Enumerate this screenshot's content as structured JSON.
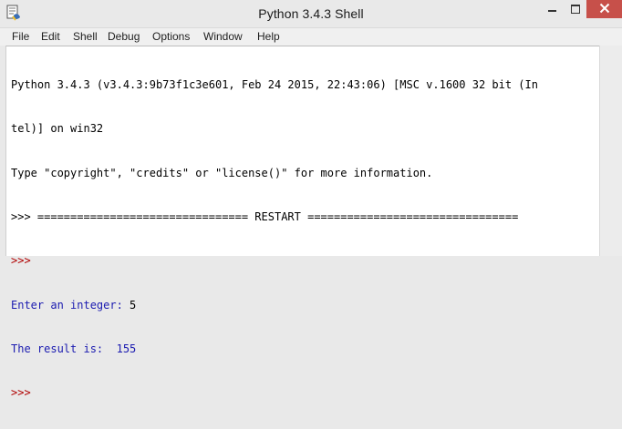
{
  "window": {
    "title": "Python 3.4.3 Shell"
  },
  "title_controls": {
    "minimize_icon": "minimize-icon",
    "maximize_icon": "maximize-icon",
    "close_icon": "close-icon"
  },
  "menu": {
    "items": [
      "File",
      "Edit",
      "Shell",
      "Debug",
      "Options",
      "Window",
      "Help"
    ]
  },
  "shell": {
    "banner_line1": "Python 3.4.3 (v3.4.3:9b73f1c3e601, Feb 24 2015, 22:43:06) [MSC v.1600 32 bit (In",
    "banner_line2": "tel)] on win32",
    "banner_line3": "Type \"copyright\", \"credits\" or \"license()\" for more information.",
    "restart_line": ">>> ================================ RESTART ================================",
    "prompt_1": ">>>",
    "input_prompt": "Enter an integer: ",
    "input_value": "5",
    "result_line": "The result is:  155",
    "prompt_2": ">>>"
  },
  "colors": {
    "prompt": "#b00000",
    "output": "#1a1ab0",
    "text": "#000000",
    "close_button": "#c7504a"
  }
}
